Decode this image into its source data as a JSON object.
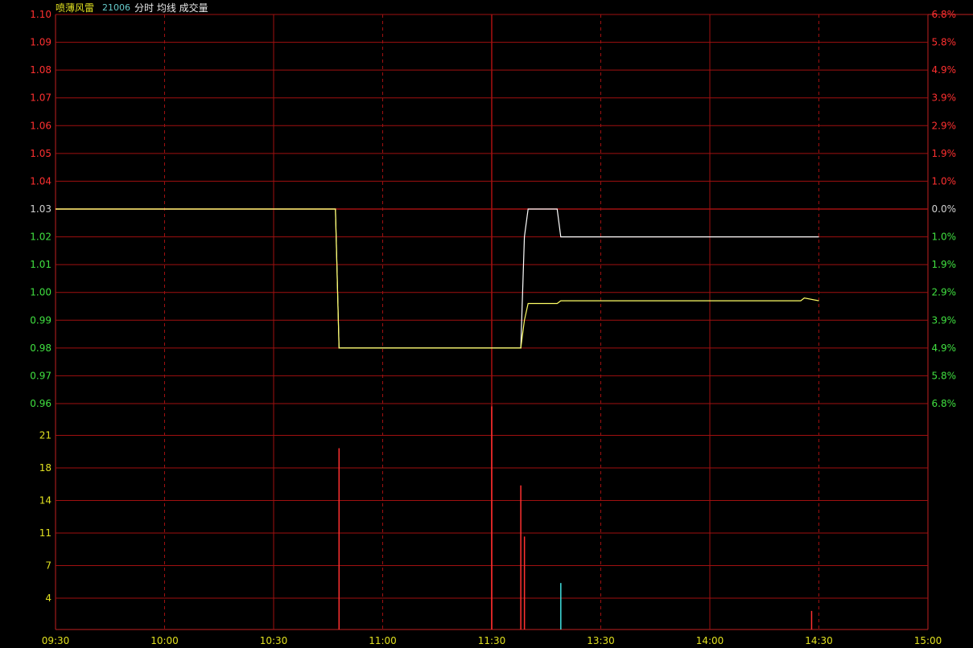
{
  "header": {
    "stock_name": "喷薄风雷",
    "stock_code": "21006",
    "tags": "分时 均线 成交量"
  },
  "colors": {
    "background": "#000000",
    "grid": "#a01010",
    "axis_line": "#c02020",
    "price_line": "#ffffff",
    "avg_line": "#ffff66",
    "up_label": "#ff3030",
    "down_label": "#40e040",
    "flat_label": "#d0d0d0",
    "volume_label": "#e0e020",
    "time_label": "#e0e020",
    "code_color": "#66cccc",
    "name_color": "#e0e020",
    "tags_color": "#e8e8e8",
    "vol_up": "#ff3030",
    "vol_down": "#40e0e0"
  },
  "chart_data": [
    {
      "type": "line",
      "title": "",
      "x_ticks": [
        "09:30",
        "10:00",
        "10:30",
        "11:00",
        "11:30",
        "13:30",
        "14:00",
        "14:30",
        "15:00"
      ],
      "y_ticks_left": [
        "1.10",
        "1.09",
        "1.08",
        "1.07",
        "1.06",
        "1.05",
        "1.04",
        "1.03",
        "1.02",
        "1.01",
        "1.00",
        "0.99",
        "0.98",
        "0.97",
        "0.96"
      ],
      "y_ticks_right": [
        "6.8%",
        "5.8%",
        "4.9%",
        "3.9%",
        "2.9%",
        "1.9%",
        "1.0%",
        "0.0%",
        "1.0%",
        "1.9%",
        "2.9%",
        "3.9%",
        "4.9%",
        "5.8%",
        "6.8%"
      ],
      "ylim": [
        0.96,
        1.1
      ],
      "prev_close": 1.03,
      "grid": true,
      "series": [
        {
          "key": "price",
          "points": [
            {
              "t": "09:30",
              "v": 1.03
            },
            {
              "t": "10:47",
              "v": 1.03
            },
            {
              "t": "10:48",
              "v": 0.98
            },
            {
              "t": "11:30",
              "v": 0.98
            },
            {
              "t": "13:30",
              "v": 0.98
            },
            {
              "t": "13:38",
              "v": 0.98
            },
            {
              "t": "13:39",
              "v": 1.02
            },
            {
              "t": "13:40",
              "v": 1.03
            },
            {
              "t": "13:48",
              "v": 1.03
            },
            {
              "t": "13:49",
              "v": 1.02
            },
            {
              "t": "15:00",
              "v": 1.02
            }
          ]
        },
        {
          "key": "average",
          "points": [
            {
              "t": "09:30",
              "v": 1.03
            },
            {
              "t": "10:47",
              "v": 1.03
            },
            {
              "t": "10:48",
              "v": 0.98
            },
            {
              "t": "11:30",
              "v": 0.98
            },
            {
              "t": "13:30",
              "v": 0.98
            },
            {
              "t": "13:38",
              "v": 0.98
            },
            {
              "t": "13:39",
              "v": 0.99
            },
            {
              "t": "13:40",
              "v": 0.996
            },
            {
              "t": "13:48",
              "v": 0.996
            },
            {
              "t": "13:49",
              "v": 0.997
            },
            {
              "t": "14:55",
              "v": 0.997
            },
            {
              "t": "14:56",
              "v": 0.998
            },
            {
              "t": "15:00",
              "v": 0.997
            }
          ]
        }
      ]
    },
    {
      "type": "bar",
      "title": "",
      "y_ticks": [
        "21",
        "18",
        "14",
        "11",
        "7",
        "4"
      ],
      "ylim": [
        0,
        24.3
      ],
      "grid": true,
      "bars": [
        {
          "t": "10:48",
          "value": 19.5,
          "dir": "up"
        },
        {
          "t": "11:30",
          "value": 24,
          "dir": "up"
        },
        {
          "t": "13:38",
          "value": 15.5,
          "dir": "up"
        },
        {
          "t": "13:39",
          "value": 10,
          "dir": "up"
        },
        {
          "t": "13:49",
          "value": 5,
          "dir": "down"
        },
        {
          "t": "14:58",
          "value": 2,
          "dir": "up"
        }
      ]
    }
  ]
}
